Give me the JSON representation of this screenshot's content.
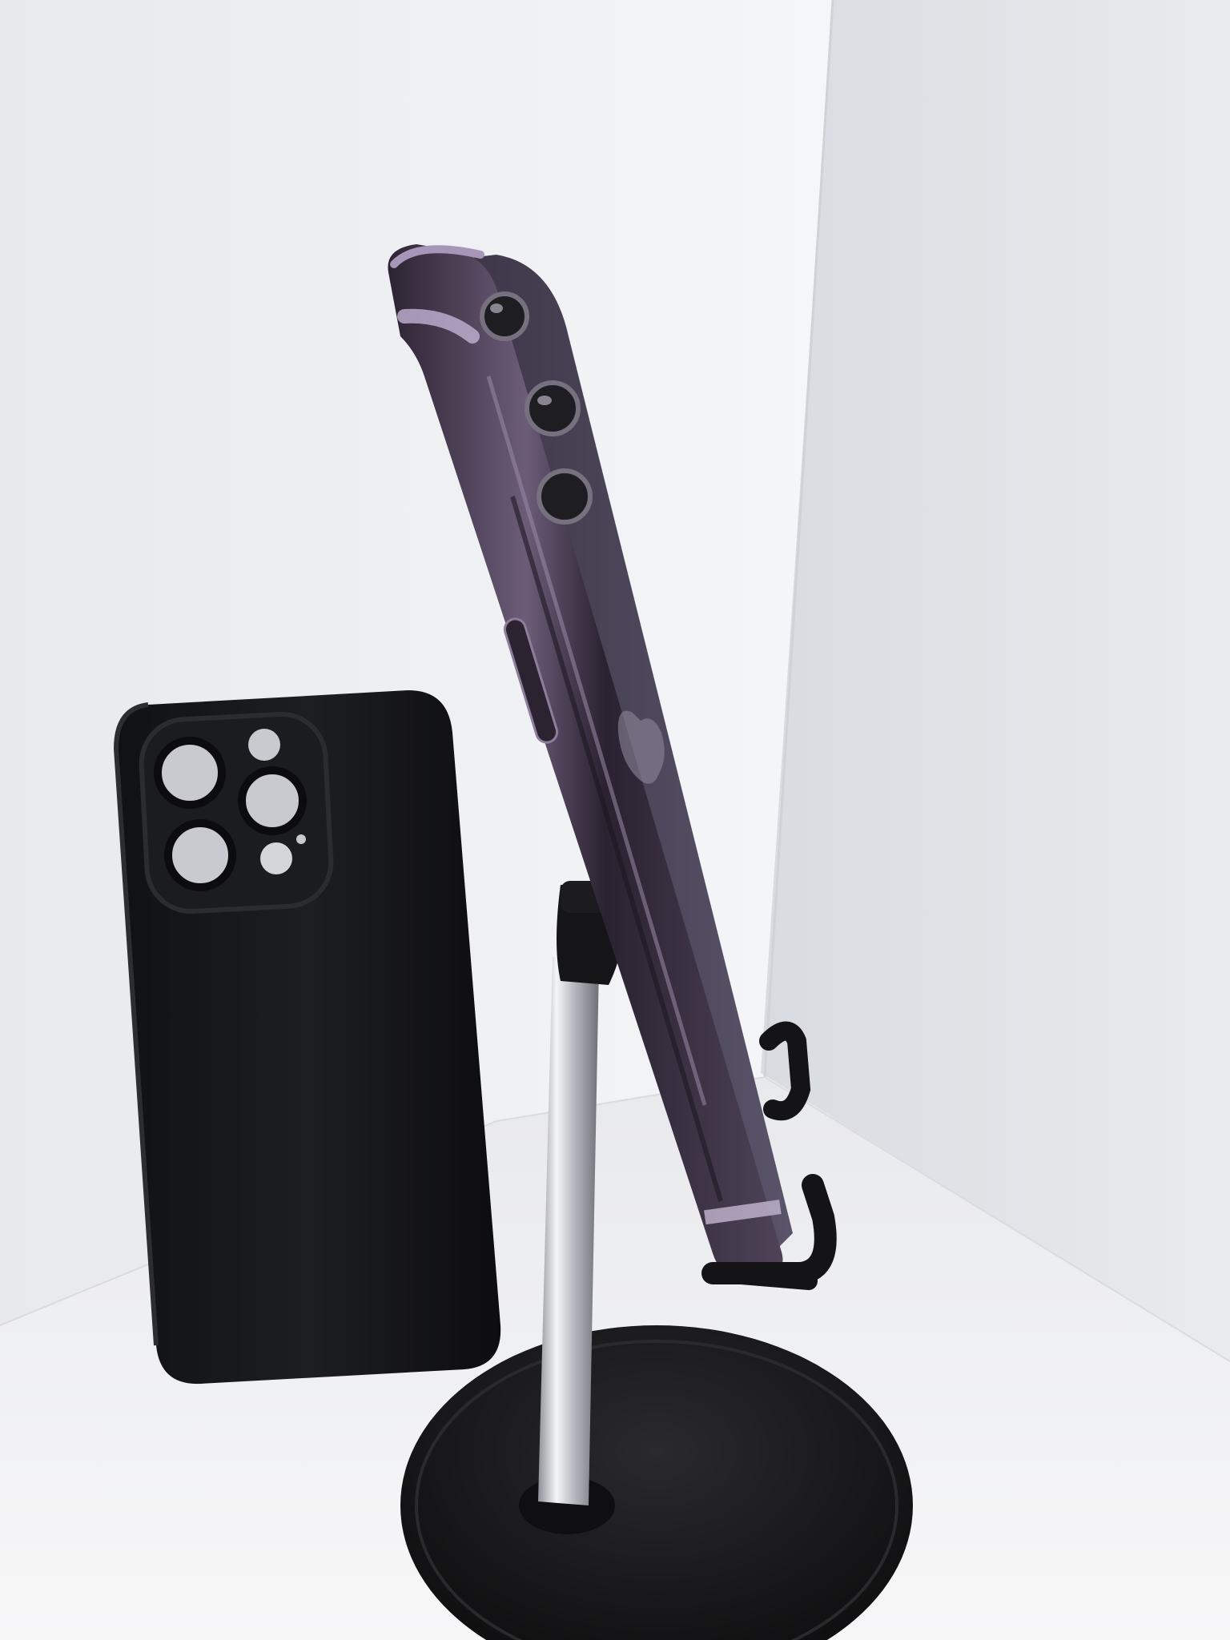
{
  "scene": {
    "subject": "phone-on-stand",
    "objects": [
      "wall-backdrop",
      "shelf-surface",
      "phone-case",
      "phone",
      "phone-stand"
    ]
  },
  "colors": {
    "wall_left": "#eef0f3",
    "wall_right": "#e2e4e8",
    "shelf": "#f1f1f3",
    "case_body": "#17181a",
    "case_edge": "#2a2b2e",
    "lens_cutout": "#cfd0d4",
    "phone_frame": "#3a3140",
    "phone_frame_highlight": "#8e7fa2",
    "phone_back": "#4a4458",
    "lens_ring": "#2a2a2e",
    "chrome": "#c9cbd0",
    "stand_black": "#121214"
  }
}
